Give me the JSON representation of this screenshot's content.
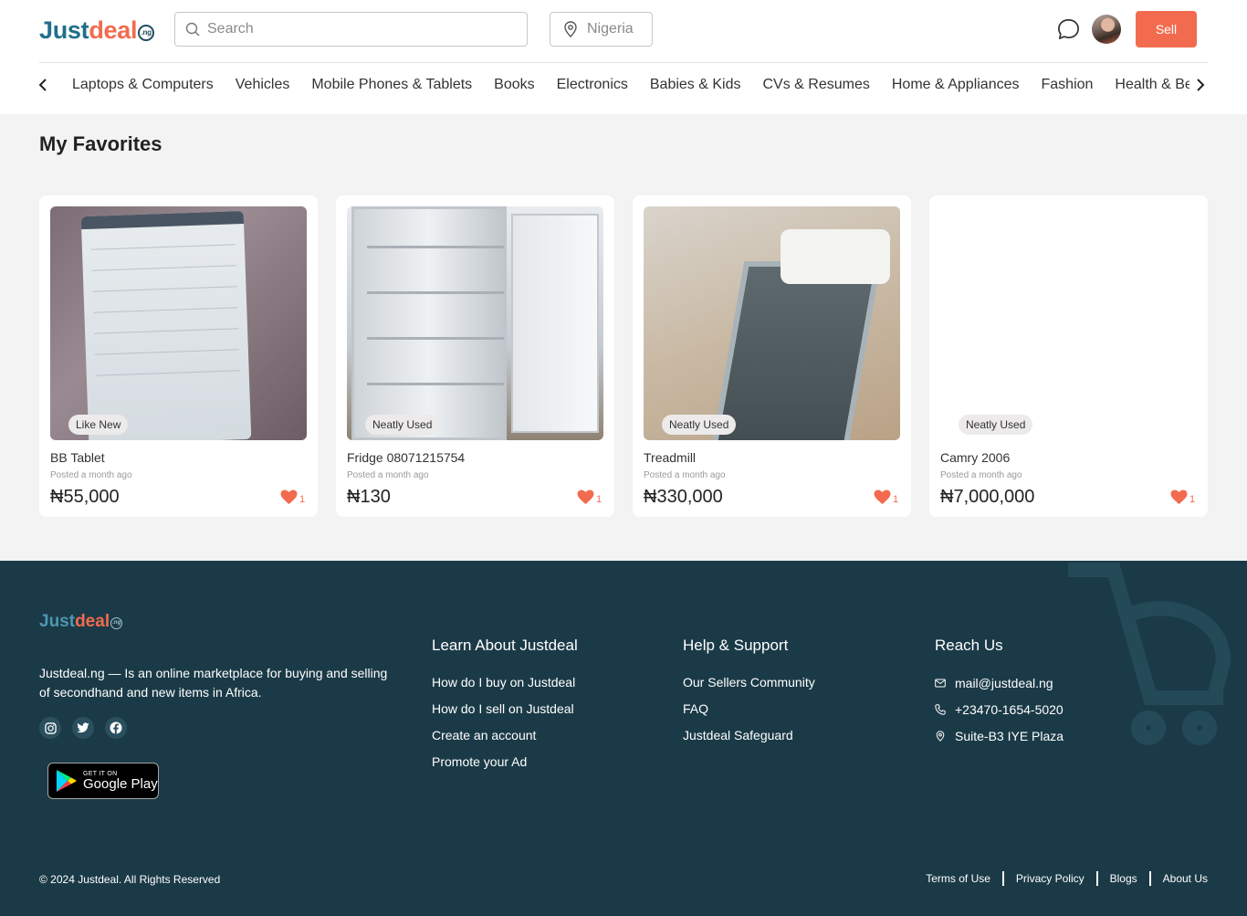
{
  "header": {
    "logo": {
      "just": "Just",
      "deal": "deal",
      "ng": ".ng"
    },
    "search_placeholder": "Search",
    "location": "Nigeria",
    "sell_label": "Sell"
  },
  "categories": [
    "Laptops & Computers",
    "Vehicles",
    "Mobile Phones & Tablets",
    "Books",
    "Electronics",
    "Babies & Kids",
    "CVs & Resumes",
    "Home & Appliances",
    "Fashion",
    "Health & Beauty"
  ],
  "page": {
    "title": "My Favorites"
  },
  "listings": [
    {
      "condition": "Like New",
      "title": "BB Tablet",
      "posted": "Posted a month ago",
      "price": "₦55,000",
      "favorites": "1"
    },
    {
      "condition": "Neatly Used",
      "title": "Fridge 08071215754",
      "posted": "Posted a month ago",
      "price": "₦130",
      "favorites": "1"
    },
    {
      "condition": "Neatly Used",
      "title": "Treadmill",
      "posted": "Posted a month ago",
      "price": "₦330,000",
      "favorites": "1"
    },
    {
      "condition": "Neatly Used",
      "title": "Camry 2006",
      "posted": "Posted a month ago",
      "price": "₦7,000,000",
      "favorites": "1"
    }
  ],
  "footer": {
    "description": "Justdeal.ng — Is an online marketplace for buying and selling of secondhand and new items in Africa.",
    "google_play": {
      "small": "GET IT ON",
      "big": "Google Play"
    },
    "learn": {
      "heading": "Learn About Justdeal",
      "links": [
        "How do I buy on Justdeal",
        "How do I sell on Justdeal",
        "Create an account",
        "Promote your Ad"
      ]
    },
    "help": {
      "heading": "Help & Support",
      "links": [
        "Our Sellers Community",
        "FAQ",
        "Justdeal Safeguard"
      ]
    },
    "reach": {
      "heading": "Reach Us",
      "email": "mail@justdeal.ng",
      "phone": "+23470-1654-5020",
      "address": "Suite-B3 IYE Plaza"
    },
    "copyright": "© 2024 Justdeal. All Rights Reserved",
    "legal": [
      "Terms of Use",
      "Privacy Policy",
      "Blogs",
      "About Us"
    ]
  },
  "colors": {
    "brand_orange": "#f26b4e",
    "brand_teal": "#1f6f8b",
    "footer_bg": "#1b3a47"
  },
  "icons": [
    "search-icon",
    "location-pin-icon",
    "chat-icon",
    "chevron-left-icon",
    "chevron-right-icon",
    "heart-icon",
    "instagram-icon",
    "twitter-icon",
    "facebook-icon",
    "mail-icon",
    "phone-icon",
    "map-pin-icon"
  ]
}
